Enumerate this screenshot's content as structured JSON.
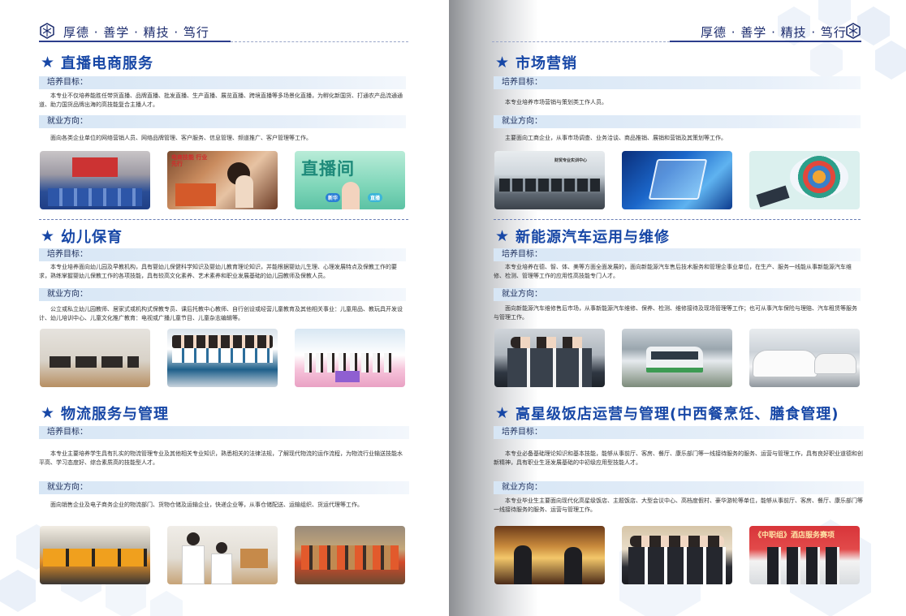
{
  "header": {
    "motto": "厚德 · 善学 · 精技 · 笃行"
  },
  "left": {
    "sections": [
      {
        "title": "直播电商服务",
        "goal_label": "培养目标：",
        "goal_text": "本专业不仅培养能胜任带货直播、品牌直播、批发直播、生产直播、展览直播、跨境直播等多场景化直播，为孵化新国货、打通农产品流通通道、助力国货品牌出海的高技能复合主播人才。",
        "career_label": "就业方向：",
        "career_text": "面向各类企业单位的网络营销人员、网络品牌管理、客户服务、信息管理、频道推广、客户管理等工作。",
        "photo_text": [
          "电商技能 行业先行",
          "直播间",
          "新华",
          "直播"
        ],
        "photos": [
          "classroom-photo",
          "livestream-host-photo",
          "livestream-studio-photo"
        ]
      },
      {
        "title": "幼儿保育",
        "goal_label": "培养目标：",
        "goal_text": "本专业培养面向幼儿园及早教机构，具有婴幼儿保健科学知识及婴幼儿教育理论知识，并能根据婴幼儿生理、心理发展特点及保教工作的要求，熟练掌握婴幼儿保教工作的各项技能，具有较高文化素养、艺术素养和职业发展基础的幼儿园教师及保教人员。",
        "career_label": "就业方向：",
        "career_text": "公立或私立幼儿园教师、居家式或机构式保教专员、课后托教中心教师、自行创设或经营儿童教育及其他相关事业：儿童用品、教玩具开发设计、幼儿培训中心、儿童文化推广教育：电视或广播儿童节目、儿童杂志编辑等。",
        "photos": [
          "piano-room-photo",
          "childcare-students-photo",
          "dance-class-photo"
        ]
      },
      {
        "title": "物流服务与管理",
        "goal_label": "培养目标：",
        "goal_text": "本专业主要培养学生具有扎实的物流管理专业及其他相关专业知识，熟悉相关的法律法规，了解现代物流的运作流程，为物流行业输送技能水平高、学习态度好、综合素质高的技能型人才。",
        "career_label": "就业方向：",
        "career_text": "面向销售企业及电子商务企业的物流部门、货物仓储及运输企业，快递企业等，从事仓储配送、运输组织、货运代理等工作。",
        "photos": [
          "logistics-trucks-photo",
          "courier-students-photo",
          "warehouse-workers-photo"
        ]
      }
    ]
  },
  "right": {
    "sections": [
      {
        "title": "市场营销",
        "goal_label": "培养目标：",
        "goal_text": "本专业培养市场营销与策划类工作人员。",
        "career_label": "就业方向：",
        "career_text": "主要面向工商企业，从事市场调查、业务洽谈、商品推销、展销和营销及其策划等工作。",
        "photo_text": [
          "财贸专业实训中心"
        ],
        "photos": [
          "computer-lab-photo",
          "digital-tablet-photo",
          "marketing-icons-photo"
        ]
      },
      {
        "title": "新能源汽车运用与维修",
        "goal_label": "培养目标：",
        "goal_text": "本专业培养在德、智、体、美等方面全面发展的，面向新能源汽车售后技术服务和管理企事业单位，在生产、服务一线能从事新能源汽车维修、检测、管理等工作的应用性高技能专门人才。",
        "career_label": "就业方向：",
        "career_text": "面向新能源汽车维修售后市场，从事新能源汽车维修、保养、检测、维修接待及现场管理等工作；也可从事汽车保险与理赔、汽车租赁等服务与管理工作。",
        "photos": [
          "auto-staff-photo",
          "electric-bus-photo",
          "car-workshop-photo"
        ]
      },
      {
        "title": "高星级饭店运营与管理(中西餐烹饪、膳食管理)",
        "goal_label": "培养目标：",
        "goal_text": "本专业必备基础理论知识和基本技能，能够从事前厅、客房、餐厅、康乐部门等一线接待服务的服务、运营与管理工作，具有良好职业道德和创新精神，具有职业生涯发展基础的中初级应用型技能人才。",
        "career_label": "就业方向：",
        "career_text": "本专业毕业生主要面向现代化高星级饭店、主题饭店、大型会议中心、高档度假村、豪华游轮等单位，能够从事前厅、客房、餐厅、康乐部门等一线接待服务的服务、运营与管理工作。",
        "photo_text": [
          "《中职组》酒店服务赛项"
        ],
        "photos": [
          "hotel-reception-photo",
          "hotel-staff-photo",
          "competition-team-photo"
        ]
      }
    ]
  }
}
